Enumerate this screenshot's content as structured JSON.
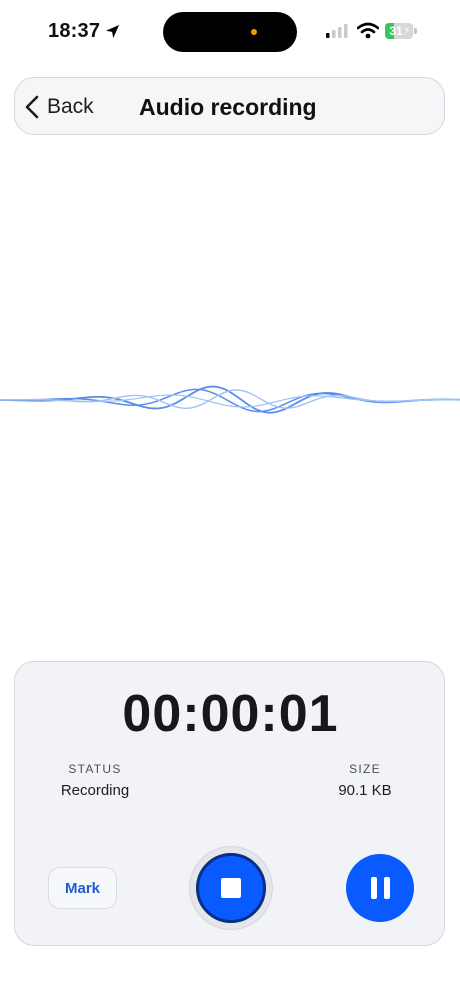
{
  "status_bar": {
    "time": "18:37",
    "battery_level": "31",
    "battery_fraction": 0.31,
    "island_dot_color": "#ff9500",
    "icons": [
      "location-arrow-icon",
      "cellular-signal-icon",
      "wifi-icon",
      "battery-icon"
    ]
  },
  "nav": {
    "back_label": "Back",
    "title": "Audio recording"
  },
  "recorder": {
    "timer": "00:00:01",
    "status_label": "STATUS",
    "status_value": "Recording",
    "size_label": "SIZE",
    "size_value": "90.1 KB",
    "mark_label": "Mark",
    "icons": [
      "stop-icon",
      "pause-icon"
    ]
  },
  "colors": {
    "accent": "#0a5bff",
    "battery_green": "#34c759",
    "wave_primary": "#5b8def",
    "wave_secondary": "#9fc3f2"
  }
}
